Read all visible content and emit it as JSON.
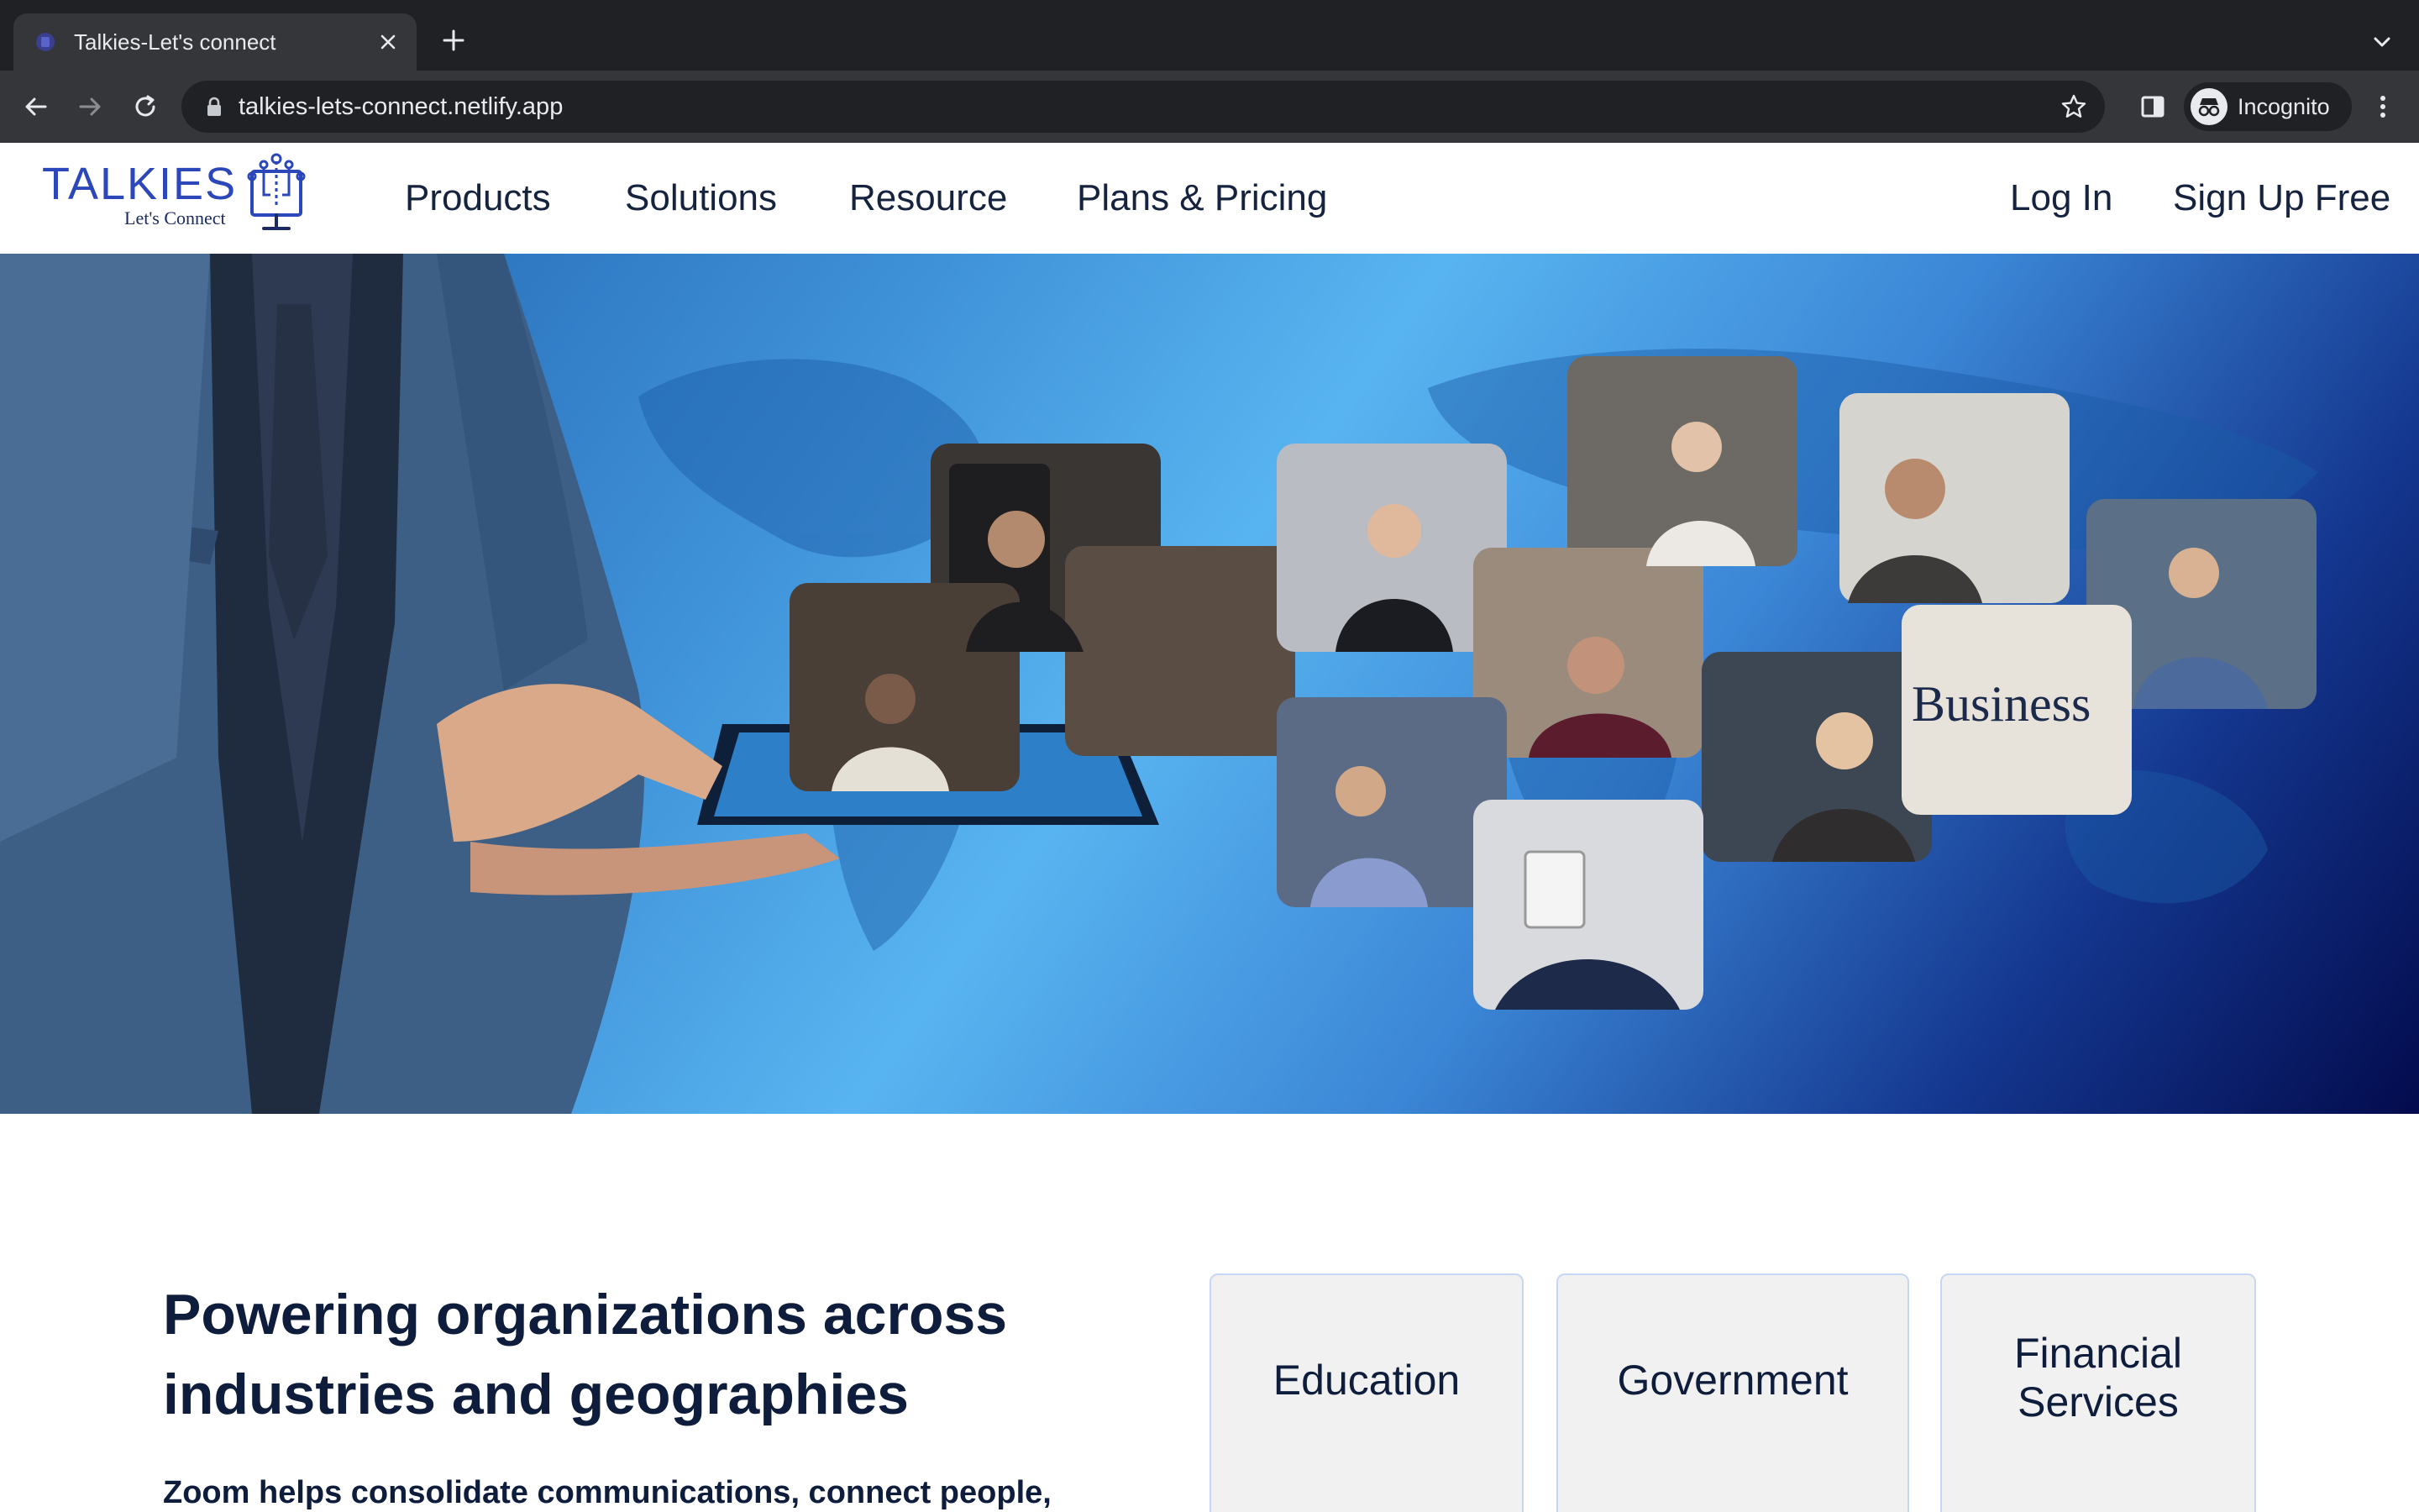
{
  "browser": {
    "tab_title": "Talkies-Let's connect",
    "url": "talkies-lets-connect.netlify.app",
    "profile_label": "Incognito"
  },
  "site": {
    "logo_word": "TALKIES",
    "logo_tagline": "Let's Connect",
    "nav": [
      "Products",
      "Solutions",
      "Resource",
      "Plans & Pricing"
    ],
    "login_label": "Log In",
    "signup_label": "Sign Up Free"
  },
  "hero": {
    "tile_text": "Business"
  },
  "industries": {
    "title": "Powering organizations across industries and geographies",
    "subtitle": "Zoom helps consolidate communications, connect people,",
    "cards": [
      "Education",
      "Government",
      "Financial Services"
    ]
  },
  "colors": {
    "brand_blue": "#2b47b9",
    "heading_navy": "#0e1d3c",
    "chrome_dark": "#202124",
    "chrome_mid": "#35363a"
  }
}
